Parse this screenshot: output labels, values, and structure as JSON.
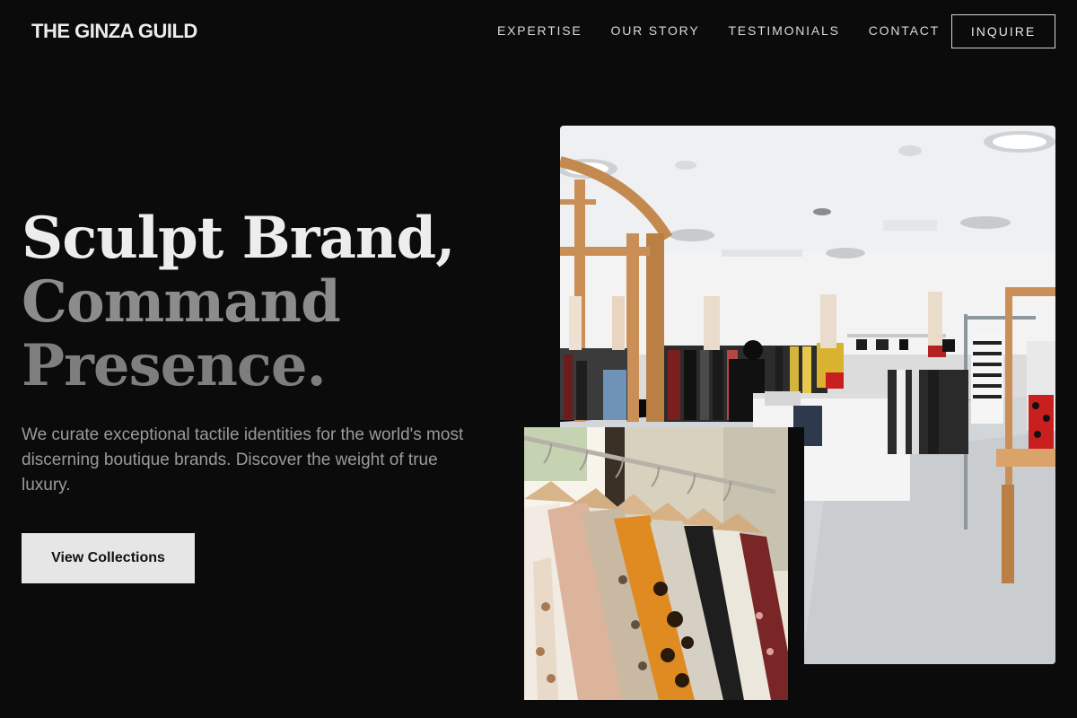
{
  "brand": {
    "name": "THE GINZA GUILD"
  },
  "nav": {
    "items": [
      {
        "label": "EXPERTISE"
      },
      {
        "label": "OUR STORY"
      },
      {
        "label": "TESTIMONIALS"
      },
      {
        "label": "CONTACT"
      }
    ],
    "cta_label": "INQUIRE"
  },
  "hero": {
    "headline_line1": "Sculpt Brand,",
    "headline_line2": "Command",
    "headline_line3": "Presence.",
    "subtitle": "We curate exceptional tactile identities for the world's most discerning boutique brands. Discover the weight of true luxury.",
    "button_label": "View Collections"
  },
  "images": {
    "main": {
      "icon": "boutique-interior-photo"
    },
    "secondary": {
      "icon": "clothing-rack-photo"
    }
  },
  "colors": {
    "background": "#0b0b0b",
    "headline_primary": "#ededed",
    "headline_muted": "#8c8c8c",
    "button_bg": "#e6e6e6"
  }
}
